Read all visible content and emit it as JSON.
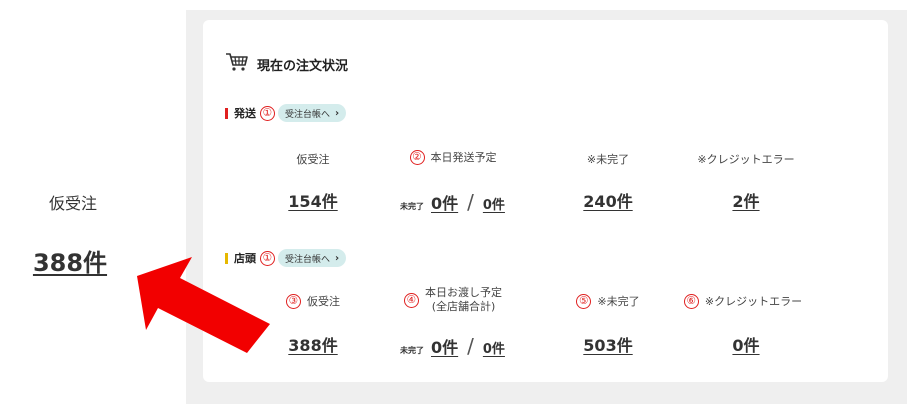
{
  "callout": {
    "label": "仮受注",
    "value": "388件"
  },
  "card": {
    "title": "現在の注文状況",
    "icon": "cart-icon"
  },
  "colors": {
    "shipping_bar": "#e02020",
    "store_bar": "#e6b800",
    "circle": "#e02020",
    "pill_bg": "#d4ecec",
    "arrow": "#f20000"
  },
  "shipping": {
    "title": "発送",
    "marker": "①",
    "link_label": "受注台帳へ",
    "chevron": "›",
    "cols": {
      "provisional": {
        "label": "仮受注",
        "value": "154件"
      },
      "today": {
        "marker": "②",
        "label": "本日発送予定",
        "mini": "未完了",
        "incomplete": "0件",
        "slash": "/",
        "total": "0件"
      },
      "incomplete": {
        "label": "※未完了",
        "value": "240件"
      },
      "credit_error": {
        "label": "※クレジットエラー",
        "value": "2件"
      }
    }
  },
  "store": {
    "title": "店頭",
    "marker": "①",
    "link_label": "受注台帳へ",
    "chevron": "›",
    "cols": {
      "provisional": {
        "marker": "③",
        "label": "仮受注",
        "value": "388件"
      },
      "today": {
        "marker": "④",
        "label_line1": "本日お渡し予定",
        "label_line2": "(全店舗合計)",
        "mini": "未完了",
        "incomplete": "0件",
        "slash": "/",
        "total": "0件"
      },
      "incomplete": {
        "marker": "⑤",
        "label": "※未完了",
        "value": "503件"
      },
      "credit_error": {
        "marker": "⑥",
        "label": "※クレジットエラー",
        "value": "0件"
      }
    }
  }
}
